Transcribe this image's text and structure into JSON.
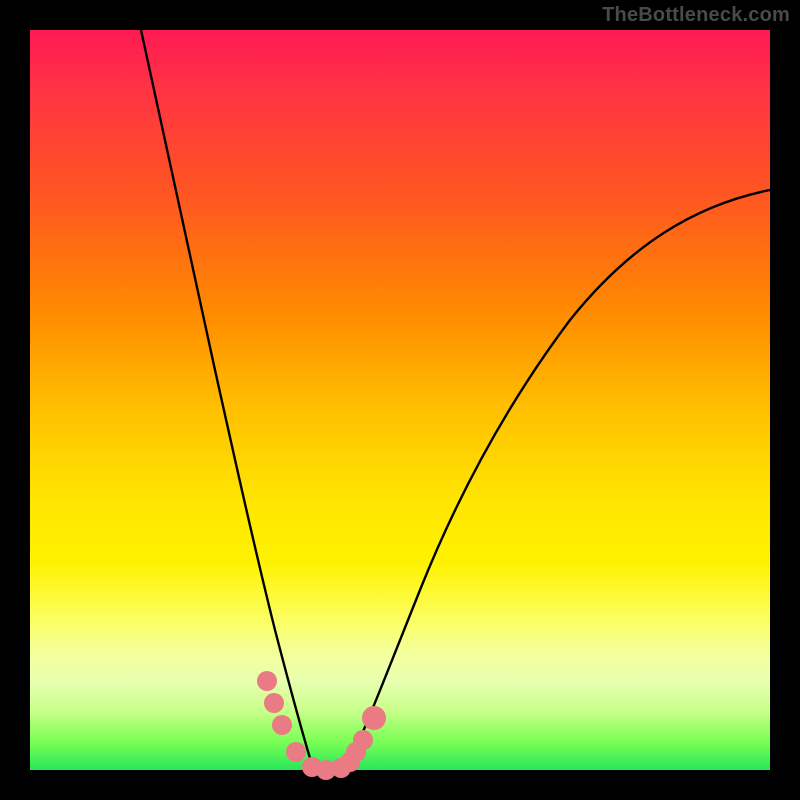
{
  "watermark": {
    "text": "TheBottleneck.com"
  },
  "chart_data": {
    "type": "line",
    "title": "",
    "xlabel": "",
    "ylabel": "",
    "xlim": [
      0,
      100
    ],
    "ylim": [
      0,
      100
    ],
    "series": [
      {
        "name": "left-curve",
        "x": [
          15,
          17,
          19,
          21,
          23,
          25,
          27,
          29,
          30.5,
          32,
          33.5,
          35,
          36.5,
          38
        ],
        "values": [
          100,
          88,
          76,
          64,
          53,
          43,
          33,
          24,
          18,
          12,
          8,
          4,
          1.5,
          0
        ]
      },
      {
        "name": "right-curve",
        "x": [
          43,
          45,
          48,
          52,
          56,
          60,
          65,
          70,
          76,
          82,
          88,
          94,
          100
        ],
        "values": [
          0,
          3,
          8,
          16,
          24,
          32,
          40,
          48,
          56,
          63,
          69,
          74,
          78
        ]
      },
      {
        "name": "valley-floor",
        "x": [
          38,
          40.5,
          43
        ],
        "values": [
          0,
          0,
          0
        ]
      }
    ],
    "markers": [
      {
        "series": "left-curve",
        "x": 32,
        "y": 12,
        "kind": "pink-dot"
      },
      {
        "series": "left-curve",
        "x": 33,
        "y": 9,
        "kind": "pink-dot"
      },
      {
        "series": "left-curve",
        "x": 34,
        "y": 6,
        "kind": "pink-dot"
      },
      {
        "series": "left-curve",
        "x": 36,
        "y": 2,
        "kind": "pink-dot"
      },
      {
        "series": "valley-floor",
        "x": 38,
        "y": 0,
        "kind": "pink-dot"
      },
      {
        "series": "valley-floor",
        "x": 40,
        "y": 0,
        "kind": "pink-dot"
      },
      {
        "series": "valley-floor",
        "x": 42,
        "y": 0,
        "kind": "pink-dot"
      },
      {
        "series": "right-curve",
        "x": 43,
        "y": 0,
        "kind": "pink-dot"
      },
      {
        "series": "right-curve",
        "x": 44,
        "y": 2,
        "kind": "pink-dot"
      },
      {
        "series": "right-curve",
        "x": 45,
        "y": 4,
        "kind": "pink-dot"
      },
      {
        "series": "right-curve",
        "x": 46.5,
        "y": 7,
        "kind": "pink-dot-large"
      }
    ],
    "background_gradient": {
      "top_color": "#ff1a53",
      "bottom_color": "#28e85a"
    }
  }
}
